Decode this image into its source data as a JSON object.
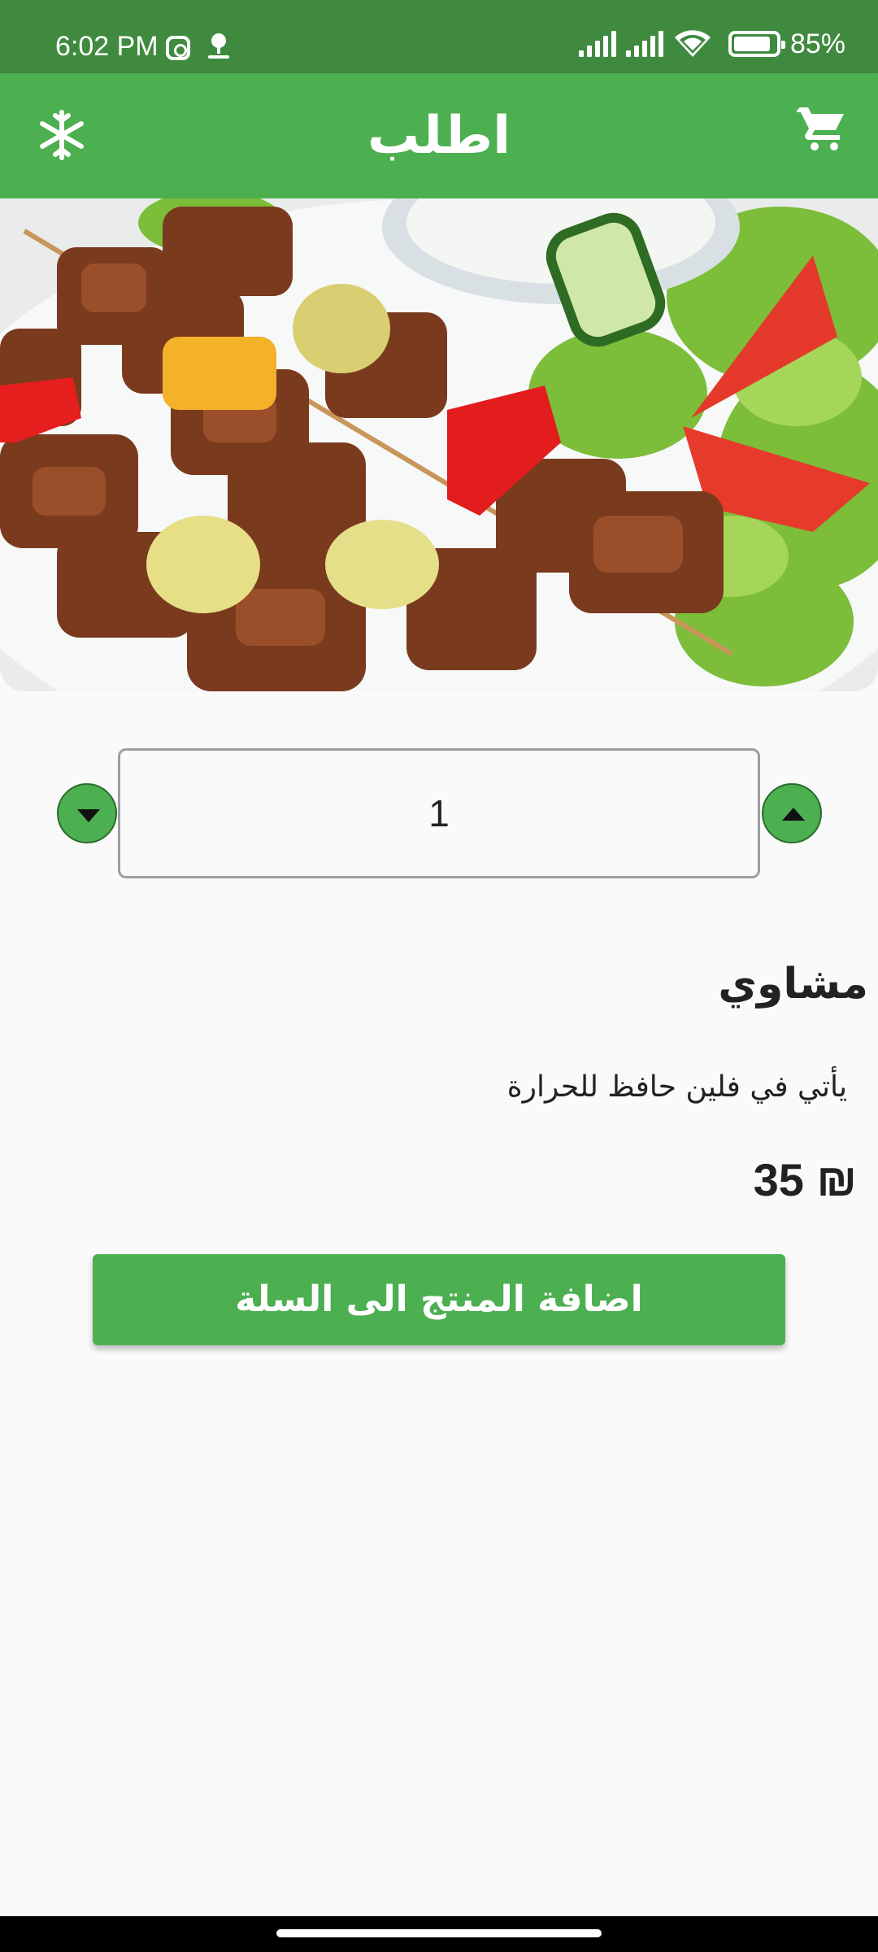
{
  "status_bar": {
    "time": "6:02 PM",
    "battery": "85%",
    "icons": [
      "instagram-icon",
      "app-notification-icon",
      "signal-icon",
      "signal-icon",
      "wifi-icon",
      "battery-icon"
    ]
  },
  "app_bar": {
    "title": "اطلب",
    "left_icon": "snowflake-icon",
    "right_icon": "cart-icon",
    "color": "#4caf50"
  },
  "product": {
    "quantity": "1",
    "name": "مشاوي",
    "description": "يأتي في فلين حافظ للحرارة",
    "price": "35 ₪"
  },
  "actions": {
    "add_to_cart": "اضافة المنتج الى السلة"
  },
  "colors": {
    "status_bar": "#3f8a3f",
    "primary": "#4caf50"
  }
}
